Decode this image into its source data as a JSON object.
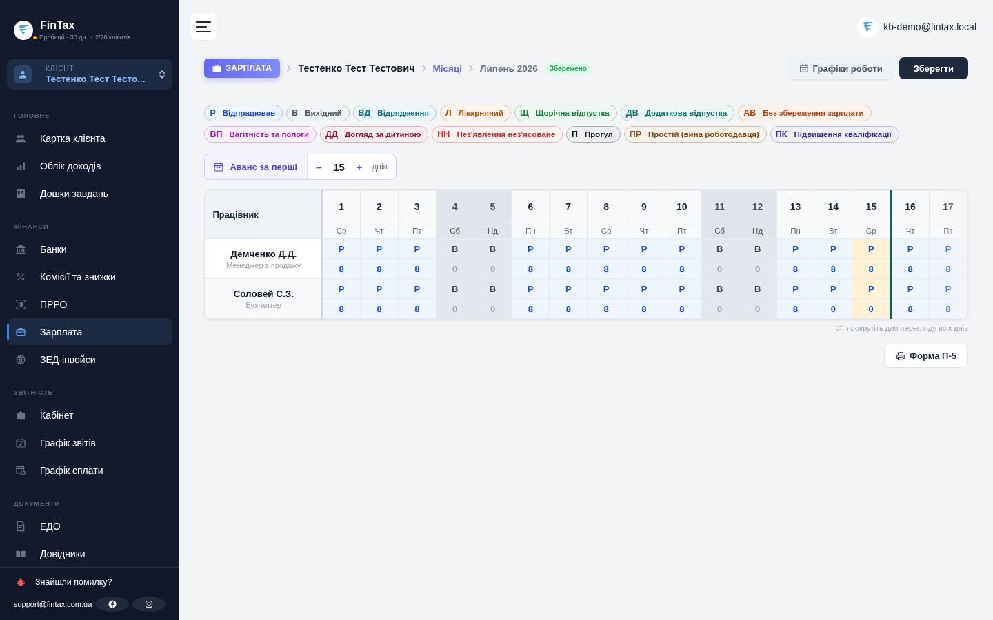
{
  "sidebar": {
    "brand": "FinTax",
    "plan": "Пробний - 30 дн.",
    "separator": "·",
    "clients": "2/70 клієнтів",
    "client_selector": {
      "label": "КЛІЄНТ",
      "value": "Тестенко Тест Тесто..."
    },
    "sections": [
      {
        "title": "ГОЛОВНЕ",
        "items": [
          {
            "label": "Картка клієнта",
            "selected": false
          },
          {
            "label": "Облік доходів",
            "selected": false
          },
          {
            "label": "Дошки завдань",
            "selected": false
          }
        ]
      },
      {
        "title": "ФІНАНСИ",
        "items": [
          {
            "label": "Банки",
            "selected": false
          },
          {
            "label": "Комісії та знижки",
            "selected": false
          },
          {
            "label": "ПРРО",
            "selected": false
          },
          {
            "label": "Зарплата",
            "selected": true
          },
          {
            "label": "ЗЕД-інвойси",
            "selected": false
          }
        ]
      },
      {
        "title": "ЗВІТНІСТЬ",
        "items": [
          {
            "label": "Кабінет",
            "selected": false
          },
          {
            "label": "Графік звітів",
            "selected": false
          },
          {
            "label": "Графік сплати",
            "selected": false
          }
        ]
      },
      {
        "title": "ДОКУМЕНТИ",
        "items": [
          {
            "label": "ЕДО",
            "selected": false
          },
          {
            "label": "Довідники",
            "selected": false
          }
        ]
      }
    ],
    "footer": {
      "bug_report": "Знайшли помилку?",
      "email": "support@fintax.com.ua"
    }
  },
  "header": {
    "user_email": "kb-demo@fintax.local"
  },
  "breadcrumb": {
    "module": "ЗАРПЛАТА",
    "client": "Тестенко Тест Тестович",
    "section": "Місяці",
    "period": "Липень 2026",
    "status": "Збережено"
  },
  "actions": {
    "schedules": "Графіки роботи",
    "save": "Зберегти"
  },
  "legend": [
    {
      "code": "Р",
      "label": "Відпрацював",
      "color": "#1d4ed8"
    },
    {
      "code": "В",
      "label": "Вихідний",
      "color": "#4b5563"
    },
    {
      "code": "ВД",
      "label": "Відрядження",
      "color": "#0e7490"
    },
    {
      "code": "Л",
      "label": "Лікарняний",
      "color": "#b45309"
    },
    {
      "code": "Щ",
      "label": "Щорічна відпустка",
      "color": "#15803d"
    },
    {
      "code": "ДВ",
      "label": "Додаткова відпустка",
      "color": "#0f766e"
    },
    {
      "code": "АВ",
      "label": "Без збереження зарплати",
      "color": "#c2410c"
    },
    {
      "code": "ВП",
      "label": "Вагітність та пологи",
      "color": "#a21caf"
    },
    {
      "code": "ДД",
      "label": "Догляд за дитиною",
      "color": "#9f1239"
    },
    {
      "code": "НН",
      "label": "Нез'явлення нез'ясоване",
      "color": "#dc2626"
    },
    {
      "code": "П",
      "label": "Прогул",
      "color": "#111827"
    },
    {
      "code": "ПР",
      "label": "Простій (вина роботодавця)",
      "color": "#854d0e"
    },
    {
      "code": "ПК",
      "label": "Підвищення кваліфікації",
      "color": "#3730a3"
    }
  ],
  "advance": {
    "label": "Аванс за перші",
    "minus": "–",
    "value": "15",
    "plus": "+",
    "unit": "днів"
  },
  "timesheet": {
    "employee_header": "Працівник",
    "days": [
      {
        "number": "1",
        "weekday": "Ср",
        "weekend": false,
        "today": false
      },
      {
        "number": "2",
        "weekday": "Чт",
        "weekend": false,
        "today": false
      },
      {
        "number": "3",
        "weekday": "Пт",
        "weekend": false,
        "today": false
      },
      {
        "number": "4",
        "weekday": "Сб",
        "weekend": true,
        "today": false
      },
      {
        "number": "5",
        "weekday": "Нд",
        "weekend": true,
        "today": false
      },
      {
        "number": "6",
        "weekday": "Пн",
        "weekend": false,
        "today": false
      },
      {
        "number": "7",
        "weekday": "Вт",
        "weekend": false,
        "today": false
      },
      {
        "number": "8",
        "weekday": "Ср",
        "weekend": false,
        "today": false
      },
      {
        "number": "9",
        "weekday": "Чт",
        "weekend": false,
        "today": false
      },
      {
        "number": "10",
        "weekday": "Пт",
        "weekend": false,
        "today": false
      },
      {
        "number": "11",
        "weekday": "Сб",
        "weekend": true,
        "today": false
      },
      {
        "number": "12",
        "weekday": "Нд",
        "weekend": true,
        "today": false
      },
      {
        "number": "13",
        "weekday": "Пн",
        "weekend": false,
        "today": false
      },
      {
        "number": "14",
        "weekday": "Вт",
        "weekend": false,
        "today": false
      },
      {
        "number": "15",
        "weekday": "Ср",
        "weekend": false,
        "today": true
      },
      {
        "number": "16",
        "weekday": "Чт",
        "weekend": false,
        "today": false
      },
      {
        "number": "17",
        "weekday": "Пт",
        "weekend": false,
        "today": false
      }
    ],
    "employees": [
      {
        "name": "Демченко Д.Д.",
        "position": "Менеджер з продажу",
        "codes": [
          "Р",
          "Р",
          "Р",
          "В",
          "В",
          "Р",
          "Р",
          "Р",
          "Р",
          "Р",
          "В",
          "В",
          "Р",
          "Р",
          "Р",
          "Р",
          "Р"
        ],
        "hours": [
          "8",
          "8",
          "8",
          "0",
          "0",
          "8",
          "8",
          "8",
          "8",
          "8",
          "0",
          "0",
          "8",
          "8",
          "8",
          "8",
          "8"
        ]
      },
      {
        "name": "Соловей С.З.",
        "position": "Бухгалтер",
        "codes": [
          "Р",
          "Р",
          "Р",
          "В",
          "В",
          "Р",
          "Р",
          "Р",
          "Р",
          "Р",
          "В",
          "В",
          "Р",
          "Р",
          "Р",
          "Р",
          "Р"
        ],
        "hours": [
          "8",
          "8",
          "8",
          "0",
          "0",
          "8",
          "8",
          "8",
          "8",
          "8",
          "0",
          "0",
          "8",
          "0",
          "0",
          "8",
          "8"
        ]
      }
    ],
    "scroll_hint": "прокрутіть для перегляду всіх днів"
  },
  "print_button": "Форма П-5"
}
